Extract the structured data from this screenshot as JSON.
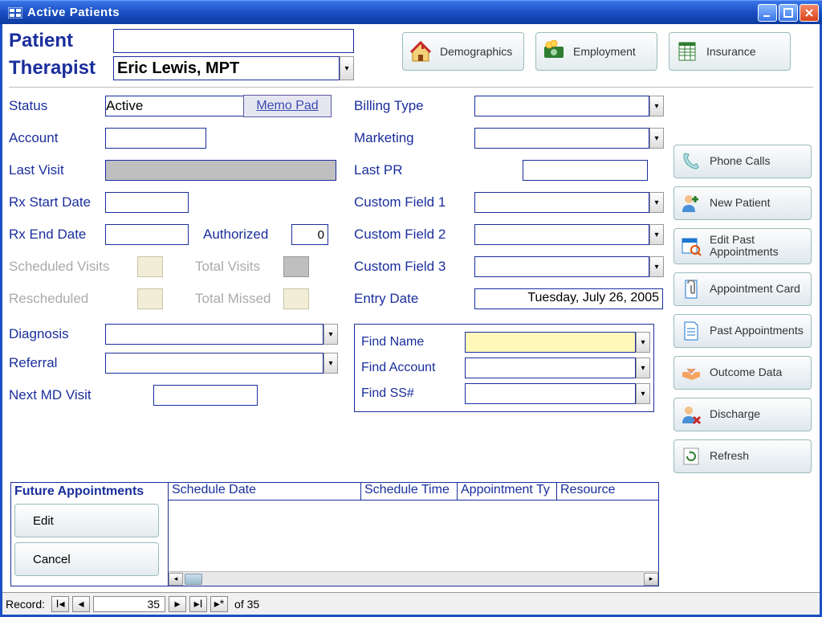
{
  "window": {
    "title": "Active Patients"
  },
  "header": {
    "patient_label": "Patient",
    "patient_value": "",
    "therapist_label": "Therapist",
    "therapist_value": "Eric Lewis, MPT"
  },
  "top_buttons": {
    "demographics": "Demographics",
    "employment": "Employment",
    "insurance": "Insurance"
  },
  "fields": {
    "status_label": "Status",
    "status_value": "Active",
    "memo_pad": "Memo Pad",
    "account_label": "Account",
    "account_value": "",
    "last_visit_label": "Last Visit",
    "rx_start_label": "Rx Start Date",
    "rx_end_label": "Rx End Date",
    "authorized_label": "Authorized",
    "authorized_value": "0",
    "scheduled_visits_label": "Scheduled Visits",
    "total_visits_label": "Total Visits",
    "rescheduled_label": "Rescheduled",
    "total_missed_label": "Total Missed",
    "diagnosis_label": "Diagnosis",
    "referral_label": "Referral",
    "next_md_label": "Next MD Visit",
    "billing_type_label": "Billing Type",
    "marketing_label": "Marketing",
    "last_pr_label": "Last PR",
    "custom1_label": "Custom Field 1",
    "custom2_label": "Custom Field 2",
    "custom3_label": "Custom Field 3",
    "entry_date_label": "Entry Date",
    "entry_date_value": "Tuesday, July 26, 2005"
  },
  "search": {
    "find_name_label": "Find Name",
    "find_account_label": "Find Account",
    "find_ss_label": "Find SS#"
  },
  "right_nav": {
    "phone_calls": "Phone Calls",
    "new_patient": "New Patient",
    "edit_past": "Edit Past Appointments",
    "appt_card": "Appointment Card",
    "past_appts": "Past Appointments",
    "outcome_data": "Outcome Data",
    "discharge": "Discharge",
    "refresh": "Refresh"
  },
  "future": {
    "header": "Future Appointments",
    "edit": "Edit",
    "cancel": "Cancel",
    "cols": {
      "schedule_date": "Schedule Date",
      "schedule_time": "Schedule Time",
      "appt_type": "Appointment Ty",
      "resource": "Resource"
    }
  },
  "record": {
    "label": "Record:",
    "current": "35",
    "of": "of  35"
  }
}
